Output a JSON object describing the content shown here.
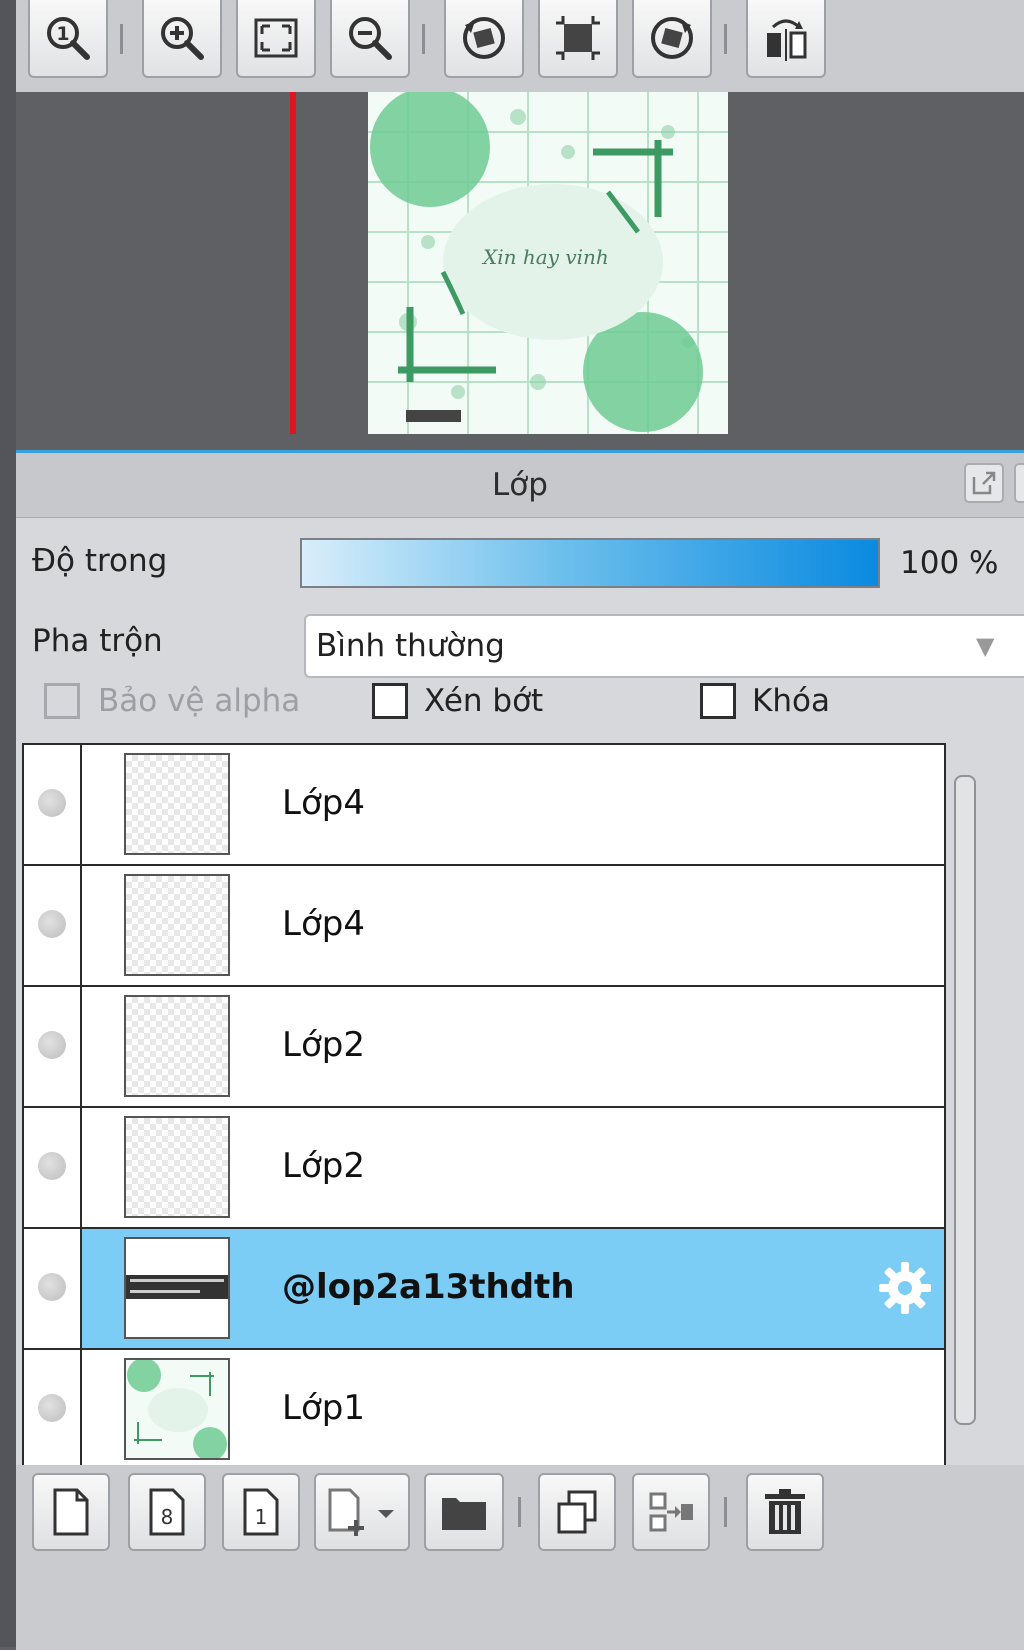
{
  "toolbar": {
    "buttons": [
      {
        "icon": "zoom-actual-size-icon"
      },
      {
        "icon": "zoom-in-icon"
      },
      {
        "icon": "fit-to-window-icon"
      },
      {
        "icon": "zoom-out-icon"
      },
      {
        "icon": "rotate-left-icon"
      },
      {
        "icon": "reset-rotation-icon"
      },
      {
        "icon": "rotate-right-icon"
      },
      {
        "icon": "flip-horizontal-icon"
      }
    ]
  },
  "navigator": {
    "preview_text": "Xin hay vinh"
  },
  "layer_panel": {
    "title": "Lớp",
    "opacity": {
      "label": "Độ trong",
      "value": "100 %",
      "fraction": 1.0
    },
    "blend": {
      "label": "Pha trộn",
      "value": "Bình thường"
    },
    "checkboxes": {
      "protect_alpha": {
        "label": "Bảo vệ alpha",
        "checked": false,
        "enabled": false
      },
      "clipping": {
        "label": "Xén bớt",
        "checked": false
      },
      "lock": {
        "label": "Khóa",
        "checked": false
      }
    },
    "layers": [
      {
        "name": "Lớp4",
        "selected": false,
        "thumbnail": "transparent"
      },
      {
        "name": "Lớp4",
        "selected": false,
        "thumbnail": "transparent"
      },
      {
        "name": "Lớp2",
        "selected": false,
        "thumbnail": "transparent"
      },
      {
        "name": "Lớp2",
        "selected": false,
        "thumbnail": "transparent"
      },
      {
        "name": "@lop2a13thdth",
        "selected": true,
        "thumbnail": "text"
      },
      {
        "name": "Lớp1",
        "selected": false,
        "thumbnail": "artwork"
      }
    ],
    "bottom_buttons": [
      {
        "icon": "new-layer-icon"
      },
      {
        "icon": "new-8bit-layer-icon"
      },
      {
        "icon": "new-1bit-layer-icon"
      },
      {
        "icon": "add-layer-dropdown-icon"
      },
      {
        "icon": "new-folder-icon"
      },
      {
        "icon": "duplicate-layer-icon"
      },
      {
        "icon": "merge-down-icon"
      },
      {
        "icon": "delete-layer-icon"
      }
    ]
  },
  "colors": {
    "accent": "#36a2dd",
    "selected_row": "#7ccdf6",
    "canvas_border": "#e0141a",
    "art_green": "#5fc48a"
  }
}
